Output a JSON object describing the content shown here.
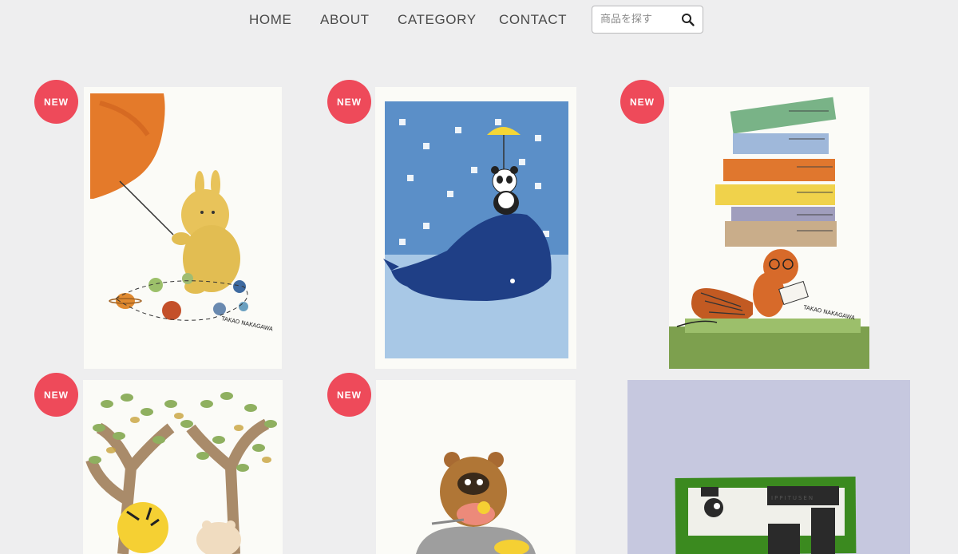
{
  "nav": {
    "items": [
      {
        "label": "HOME"
      },
      {
        "label": "ABOUT"
      },
      {
        "label": "CATEGORY"
      },
      {
        "label": "CONTACT"
      }
    ],
    "search": {
      "placeholder": "商品を探す",
      "icon": "search-icon"
    }
  },
  "badge_label": "NEW",
  "products": [
    {
      "art": "rabbit-with-sun-and-planets",
      "badge": true
    },
    {
      "art": "panda-on-whale-in-snow",
      "badge": true
    },
    {
      "art": "squirrel-reading-under-books",
      "badge": true
    },
    {
      "art": "tiger-and-bear-under-trees",
      "badge": true
    },
    {
      "art": "tanuki-eating",
      "badge": true
    },
    {
      "art": "panda-wooden-sign-ippitusen",
      "badge": false
    }
  ],
  "signature_text": "TAKAO NAKAGAWA",
  "sign_text": "IPPITUSEN"
}
